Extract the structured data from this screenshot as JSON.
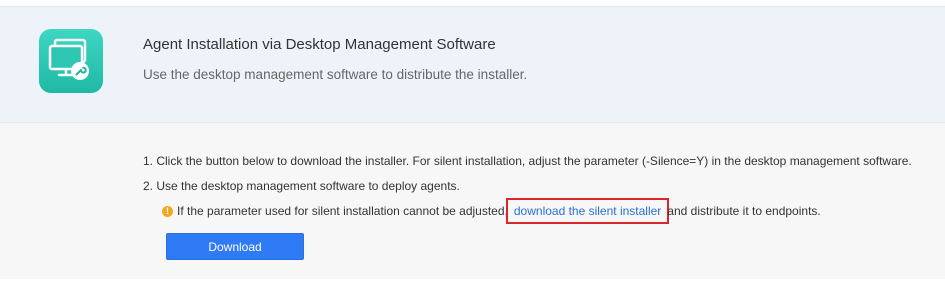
{
  "header": {
    "icon": "desktop-management-icon",
    "title": "Agent Installation via Desktop Management Software",
    "subtitle": "Use the desktop management software to distribute the installer."
  },
  "steps": [
    "1. Click the button below to download the installer. For silent installation, adjust the parameter (-Silence=Y) in the desktop management software.",
    "2. Use the desktop management software to deploy agents."
  ],
  "warning": {
    "icon": "warning-icon",
    "prefix": "If the parameter used for silent installation cannot be adjusted,",
    "link_label": "download the silent installer",
    "suffix": "and distribute it to endpoints."
  },
  "download_label": "Download",
  "colors": {
    "accent": "#2f7bf5",
    "icon_teal": "#1fb9a6",
    "warning": "#f5a623",
    "highlight_box": "#d9262d"
  }
}
